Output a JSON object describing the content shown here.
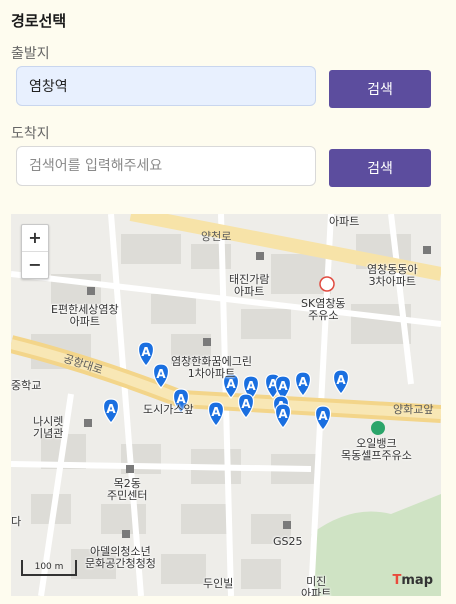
{
  "section_title": "경로선택",
  "origin": {
    "label": "출발지",
    "value": "염창역",
    "button": "검색"
  },
  "destination": {
    "label": "도착지",
    "placeholder": "검색어를 입력해주세요",
    "value": "",
    "button": "검색"
  },
  "map": {
    "zoom_in": "+",
    "zoom_out": "−",
    "scale": "100 m",
    "logo_a": "T",
    "logo_b": "map",
    "roads": [
      "양천로",
      "공항대로",
      "양화교앞"
    ],
    "places": [
      "아파트",
      "태진가람",
      "아파트",
      "SK염창동",
      "주유소",
      "염창동동아",
      "3차아파트",
      "E편한세상염창",
      "아파트",
      "염창한화꿈에그린",
      "1차아파트",
      "나시렛",
      "기념관",
      "도시가스앞",
      "목2동",
      "주민센터",
      "오일뱅크",
      "목동셀프주유소",
      "GS25",
      "아델의청소년",
      "문화공간청청청",
      "두인빌",
      "미진",
      "아파트",
      "중학교",
      "다"
    ],
    "marker_glyph": "A"
  },
  "colors": {
    "accent": "#5c4d9e",
    "marker": "#1a6fe0"
  }
}
